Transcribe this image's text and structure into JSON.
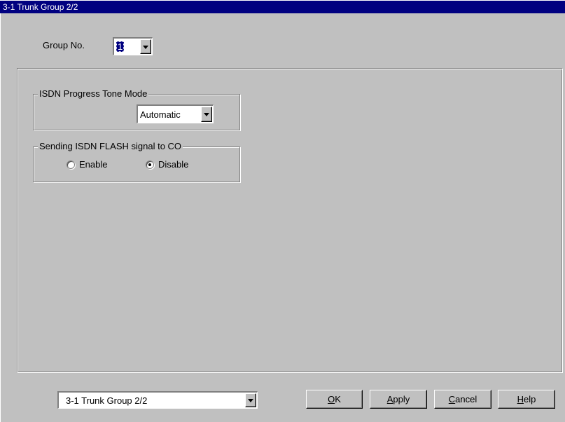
{
  "window": {
    "title": "3-1 Trunk Group 2/2"
  },
  "group_no": {
    "label": "Group No.",
    "value": "1"
  },
  "progress_tone": {
    "title": "ISDN Progress Tone Mode",
    "value": "Automatic"
  },
  "flash_signal": {
    "title": "Sending ISDN FLASH signal to CO",
    "options": [
      {
        "label": "Enable",
        "selected": false
      },
      {
        "label": "Disable",
        "selected": true
      }
    ]
  },
  "footer": {
    "page_select": "3-1 Trunk Group 2/2",
    "ok": {
      "mnemonic": "O",
      "rest": "K"
    },
    "apply": {
      "mnemonic": "A",
      "rest": "pply"
    },
    "cancel": {
      "mnemonic": "C",
      "rest": "ancel"
    },
    "help": {
      "mnemonic": "H",
      "rest": "elp"
    }
  }
}
